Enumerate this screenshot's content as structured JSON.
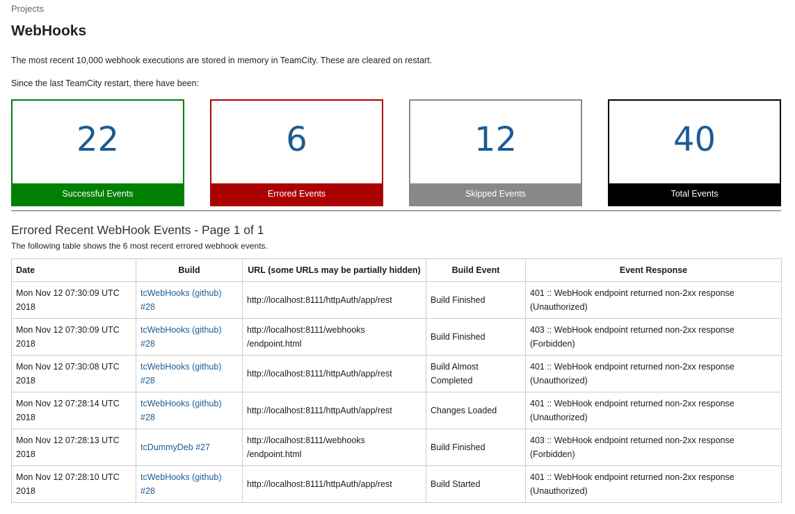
{
  "breadcrumb": "Projects",
  "title": "WebHooks",
  "intro": {
    "line1": "The most recent 10,000 webhook executions are stored in memory in TeamCity. These are cleared on restart.",
    "line2": "Since the last TeamCity restart, there have been:"
  },
  "stats": {
    "successful": {
      "count": "22",
      "label": "Successful Events",
      "color": "#008000"
    },
    "errored": {
      "count": "6",
      "label": "Errored Events",
      "color": "#aa0000"
    },
    "skipped": {
      "count": "12",
      "label": "Skipped Events",
      "color": "#888888"
    },
    "total": {
      "count": "40",
      "label": "Total Events",
      "color": "#000000"
    }
  },
  "section": {
    "title": "Errored Recent WebHook Events - Page 1 of 1",
    "subtitle": "The following table shows the 6 most recent errored webhook events."
  },
  "table": {
    "headers": [
      "Date",
      "Build",
      "URL (some URLs may be partially hidden)",
      "Build Event",
      "Event Response"
    ],
    "rows": [
      {
        "date": "Mon Nov 12 07:30:09 UTC 2018",
        "build": "tcWebHooks (github) #28",
        "url": "http://localhost:8111/httpAuth/app/rest",
        "event": "Build Finished",
        "response": "401 :: WebHook endpoint returned non-2xx response (Unauthorized)"
      },
      {
        "date": "Mon Nov 12 07:30:09 UTC 2018",
        "build": "tcWebHooks (github) #28",
        "url": "http://localhost:8111/webhooks /endpoint.html",
        "event": "Build Finished",
        "response": "403 :: WebHook endpoint returned non-2xx response (Forbidden)"
      },
      {
        "date": "Mon Nov 12 07:30:08 UTC 2018",
        "build": "tcWebHooks (github) #28",
        "url": "http://localhost:8111/httpAuth/app/rest",
        "event": "Build Almost Completed",
        "response": "401 :: WebHook endpoint returned non-2xx response (Unauthorized)"
      },
      {
        "date": "Mon Nov 12 07:28:14 UTC 2018",
        "build": "tcWebHooks (github) #28",
        "url": "http://localhost:8111/httpAuth/app/rest",
        "event": "Changes Loaded",
        "response": "401 :: WebHook endpoint returned non-2xx response (Unauthorized)"
      },
      {
        "date": "Mon Nov 12 07:28:13 UTC 2018",
        "build": "tcDummyDeb #27",
        "url": "http://localhost:8111/webhooks /endpoint.html",
        "event": "Build Finished",
        "response": "403 :: WebHook endpoint returned non-2xx response (Forbidden)"
      },
      {
        "date": "Mon Nov 12 07:28:10 UTC 2018",
        "build": "tcWebHooks (github) #28",
        "url": "http://localhost:8111/httpAuth/app/rest",
        "event": "Build Started",
        "response": "401 :: WebHook endpoint returned non-2xx response (Unauthorized)"
      }
    ]
  }
}
